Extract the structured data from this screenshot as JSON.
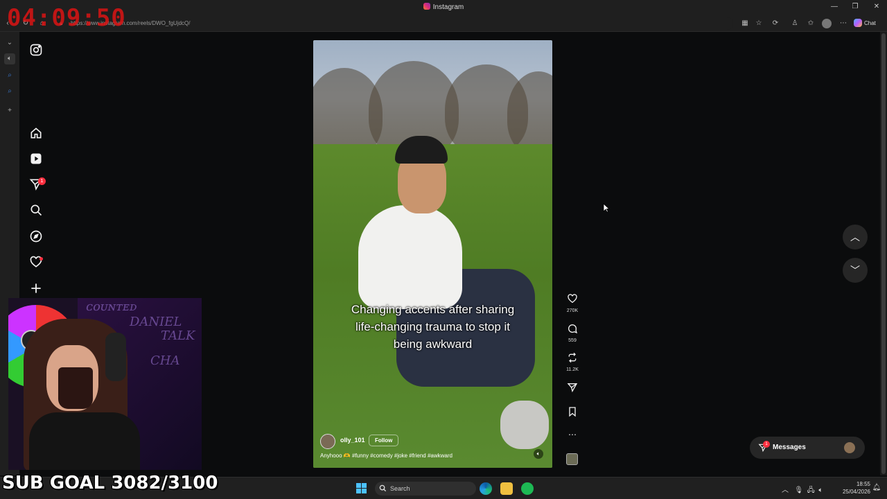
{
  "overlay": {
    "timer": "04:09:50",
    "sub_goal": "SUB GOAL 3082/3100"
  },
  "browser": {
    "window_title": "Instagram",
    "url": "https://www.instagram.com/reels/DWO_fgUjdcQ/",
    "chat_label": "Chat"
  },
  "instagram": {
    "nav_badge_count": "1",
    "reel": {
      "caption": "Changing accents after sharing life-changing trauma to stop it being awkward",
      "username": "olly_101",
      "follow_label": "Follow",
      "description": "Anyhooo 🫶 #funny #comedy #joke #friend #awkward"
    },
    "actions": {
      "likes": "270K",
      "comments": "559",
      "reposts": "11.2K"
    },
    "messages": {
      "label": "Messages",
      "badge": "1"
    }
  },
  "taskbar": {
    "search_placeholder": "Search",
    "time": "18:55",
    "date": "25/04/2026"
  },
  "colors": {
    "instagram_badge": "#ff3040",
    "timer_red": "#dc1414",
    "windows_blue": "#4cc2ff"
  }
}
